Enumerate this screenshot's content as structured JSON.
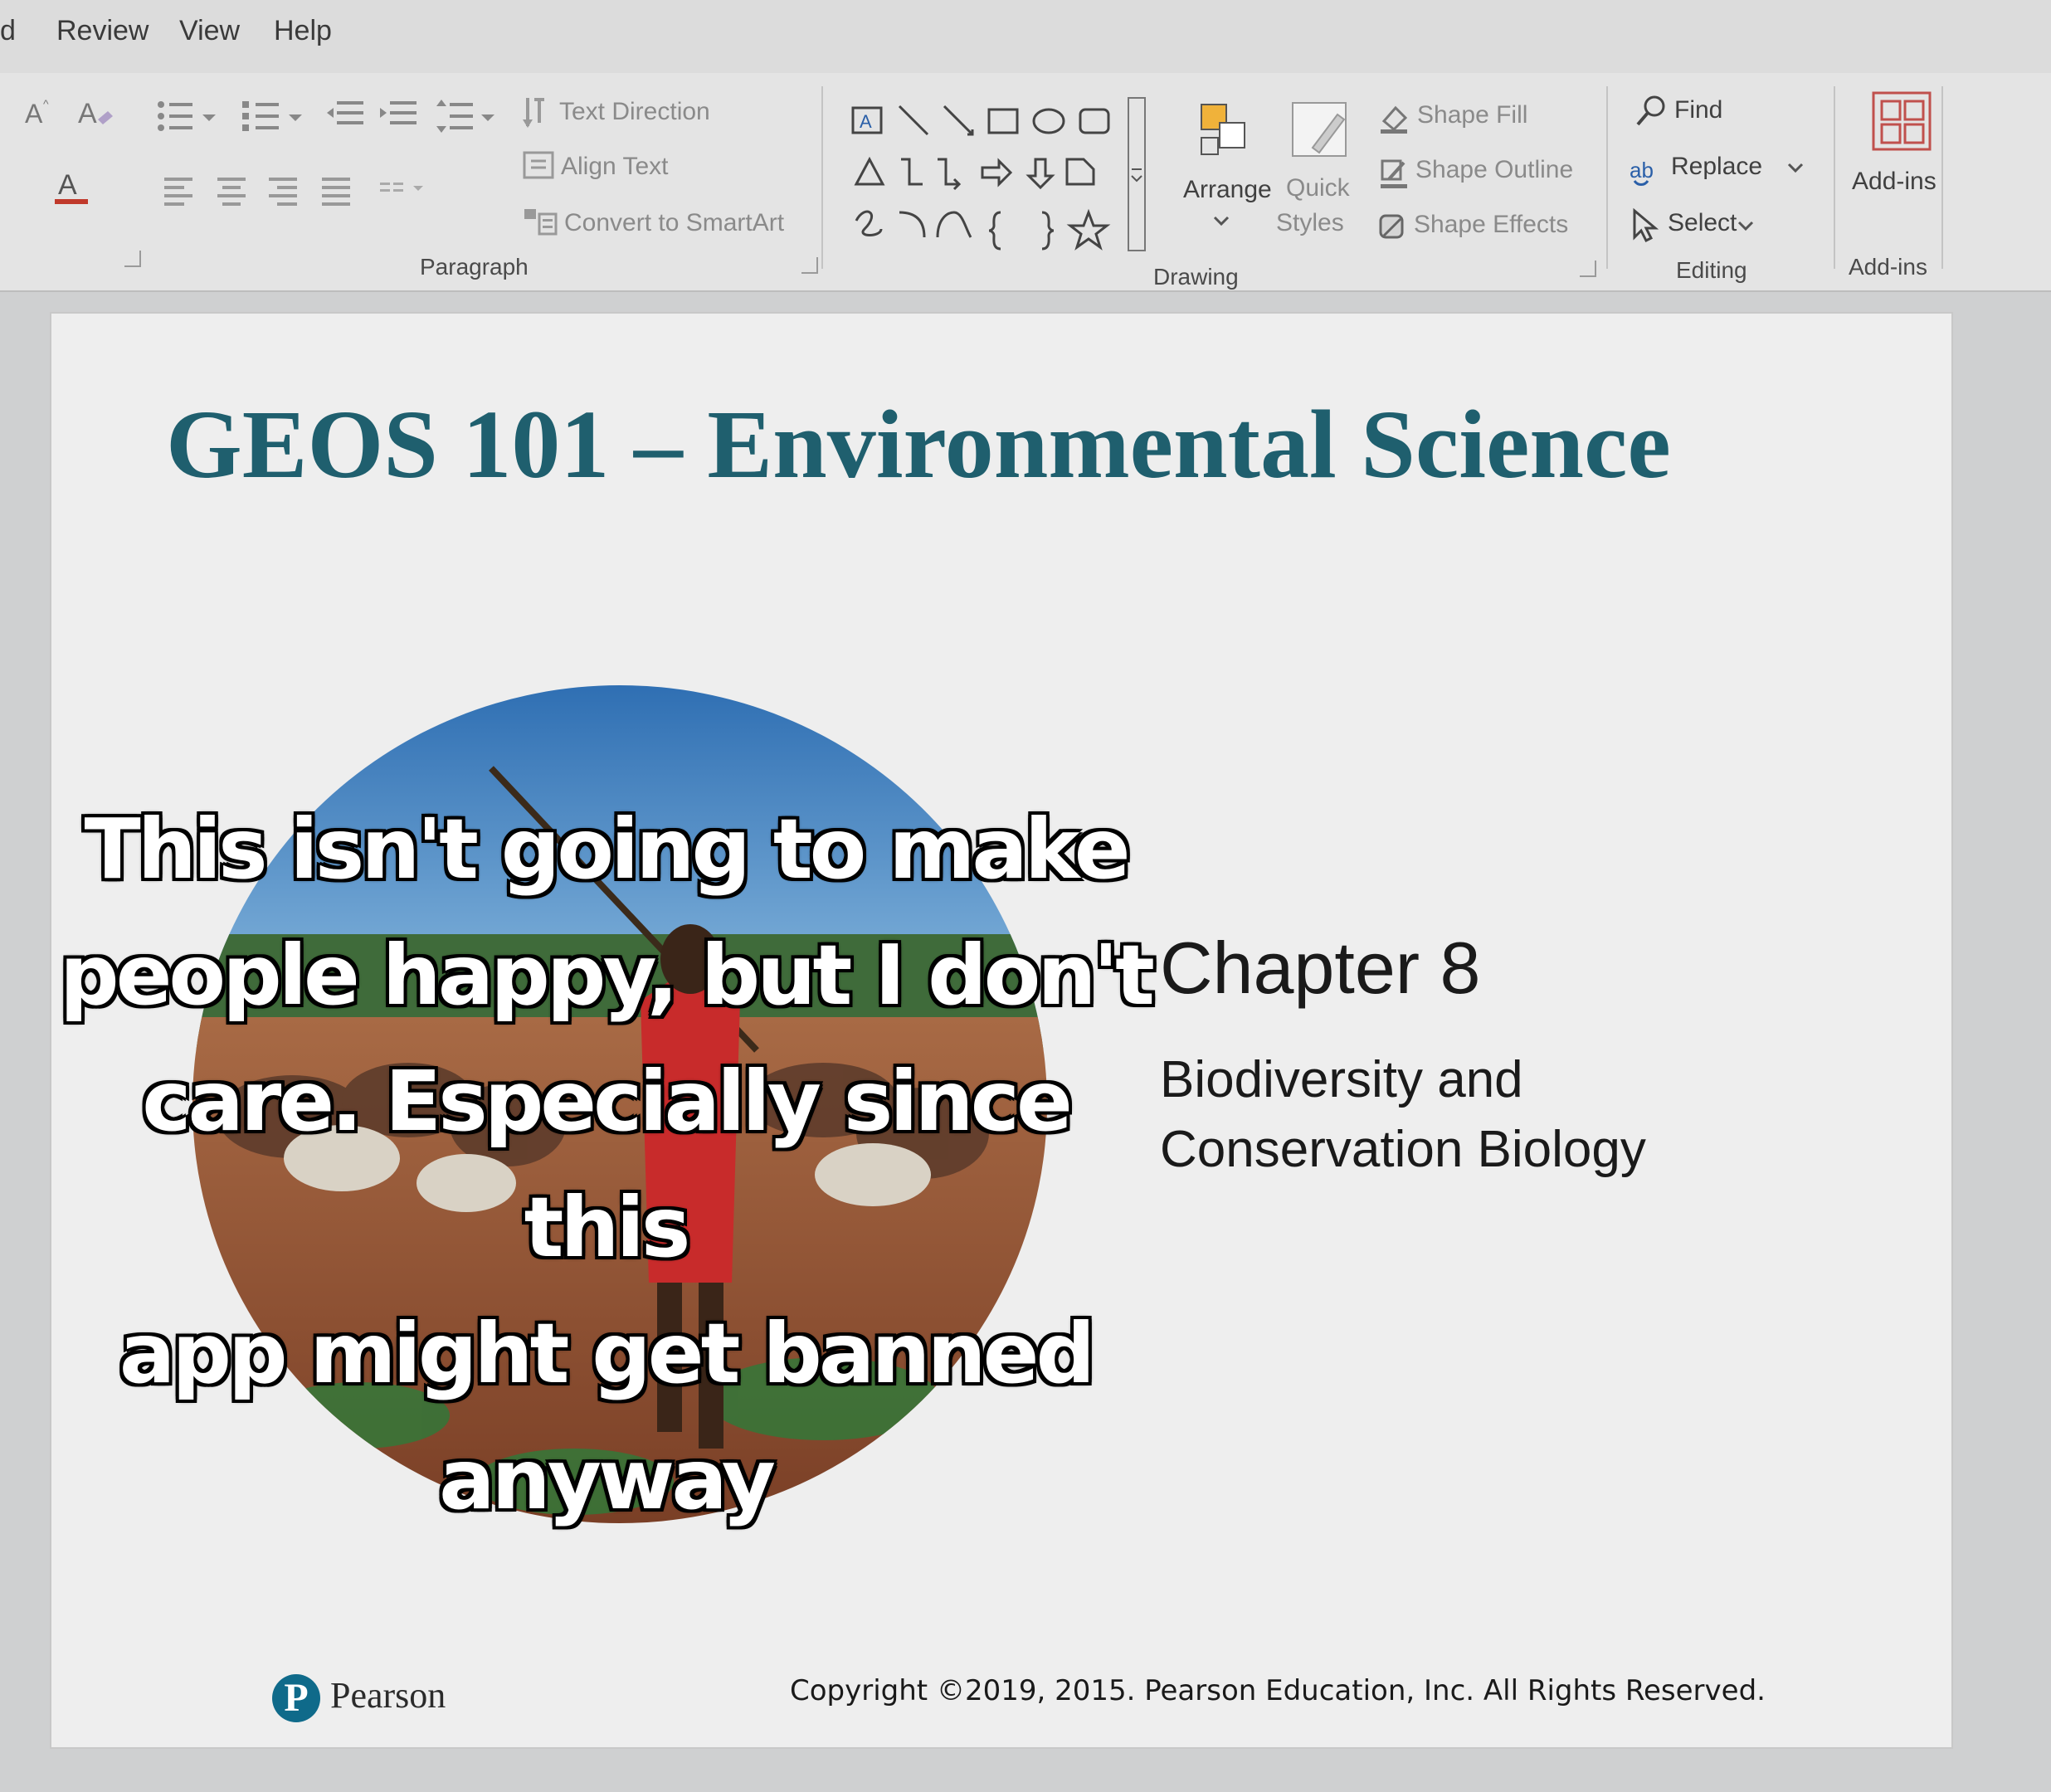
{
  "menu": {
    "items": [
      "d",
      "Review",
      "View",
      "Help"
    ]
  },
  "ribbon": {
    "paragraph": {
      "label": "Paragraph",
      "text_direction": "Text Direction",
      "align_text": "Align Text",
      "convert_smartart": "Convert to SmartArt"
    },
    "drawing": {
      "label": "Drawing",
      "arrange": "Arrange",
      "quick_styles_1": "Quick",
      "quick_styles_2": "Styles",
      "shape_fill": "Shape Fill",
      "shape_outline": "Shape Outline",
      "shape_effects": "Shape Effects"
    },
    "editing": {
      "label": "Editing",
      "find": "Find",
      "replace": "Replace",
      "select": "Select"
    },
    "addins": {
      "label": "Add-ins",
      "button": "Add-ins"
    }
  },
  "slide": {
    "title": "GEOS 101 – Environmental Science",
    "chapter": "Chapter 8",
    "subtitle_line1": "Biodiversity and",
    "subtitle_line2": "Conservation Biology",
    "logo_letter": "P",
    "publisher": "Pearson",
    "copyright": "Copyright ©2019, 2015. Pearson Education, Inc. All Rights Reserved."
  },
  "caption": {
    "lines": [
      "This isn't going to make",
      "people happy, but I don't",
      "care. Especially since this",
      "app might get banned",
      "anyway"
    ]
  },
  "colors": {
    "title": "#1f5f6e",
    "addins_icon": "#c0504d",
    "pearson_logo": "#0f6a8a"
  }
}
